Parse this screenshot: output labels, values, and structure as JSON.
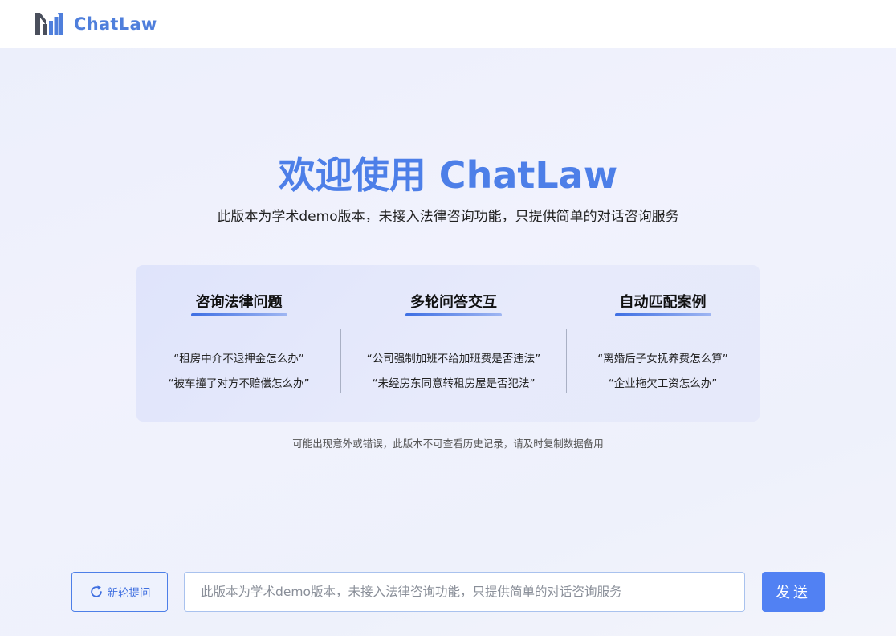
{
  "header": {
    "brand_name": "ChatLaw",
    "logo_icon": "chatlaw-bar-chart-logo-icon"
  },
  "hero": {
    "title": "欢迎使用 ChatLaw",
    "subtitle": "此版本为学术demo版本，未接入法律咨询功能，只提供简单的对话咨询服务"
  },
  "features": [
    {
      "title": "咨询法律问题",
      "examples": [
        "“租房中介不退押金怎么办”",
        "“被车撞了对方不赔偿怎么办”"
      ]
    },
    {
      "title": "多轮问答交互",
      "examples": [
        "“公司强制加班不给加班费是否违法”",
        "“未经房东同意转租房屋是否犯法”"
      ]
    },
    {
      "title": "自动匹配案例",
      "examples": [
        "“离婚后子女抚养费怎么算”",
        "“企业拖欠工资怎么办”"
      ]
    }
  ],
  "notice": "可能出现意外或错误，此版本不可查看历史记录，请及时复制数据备用",
  "input_bar": {
    "new_round_label": "新轮提问",
    "new_round_icon": "refresh-icon",
    "placeholder": "此版本为学术demo版本，未接入法律咨询功能，只提供简单的对话咨询服务",
    "send_label": "发送"
  },
  "colors": {
    "brand": "#4f7fdc",
    "accent": "#5181f3",
    "title": "#4d7fe8"
  }
}
